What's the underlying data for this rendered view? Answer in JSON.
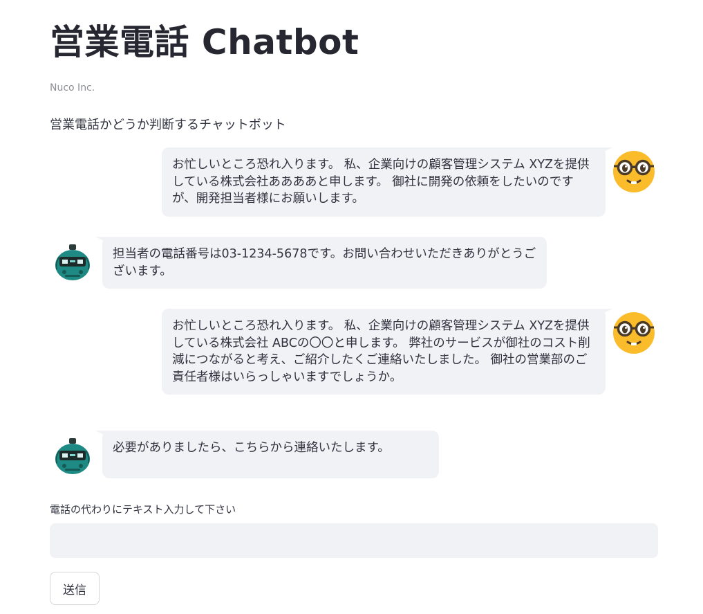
{
  "header": {
    "title": "営業電話 Chatbot",
    "caption": "Nuco Inc.",
    "description": "営業電話かどうか判断するチャットボット"
  },
  "messages": [
    {
      "role": "user",
      "avatar_icon": "nerd-face-icon",
      "text": "お忙しいところ恐れ入ります。 私、企業向けの顧客管理システム XYZを提供している株式会社ああああと申します。 御社に開発の依頼をしたいのですが、開発担当者様にお願いします。"
    },
    {
      "role": "bot",
      "avatar_icon": "robot-icon",
      "text": "担当者の電話番号は03-1234-5678です。お問い合わせいただきありがとうございます。"
    },
    {
      "role": "user",
      "avatar_icon": "nerd-face-icon",
      "text": "お忙しいところ恐れ入ります。 私、企業向けの顧客管理システム XYZを提供している株式会社 ABCの〇〇と申します。 弊社のサービスが御社のコスト削減につながると考え、ご紹介したくご連絡いたしました。 御社の営業部のご責任者様はいらっしゃいますでしょうか。"
    },
    {
      "role": "bot",
      "avatar_icon": "robot-icon",
      "text": "必要がありましたら、こちらから連絡いたします。"
    }
  ],
  "input": {
    "label": "電話の代わりにテキスト入力して下さい",
    "value": "",
    "placeholder": ""
  },
  "send_button": {
    "label": "送信"
  },
  "colors": {
    "bubble_bg": "#f0f2f6",
    "text": "#31333f",
    "caption": "#8d8f95",
    "user_avatar": "#fbbc2c",
    "bot_avatar": "#1f8a84"
  }
}
